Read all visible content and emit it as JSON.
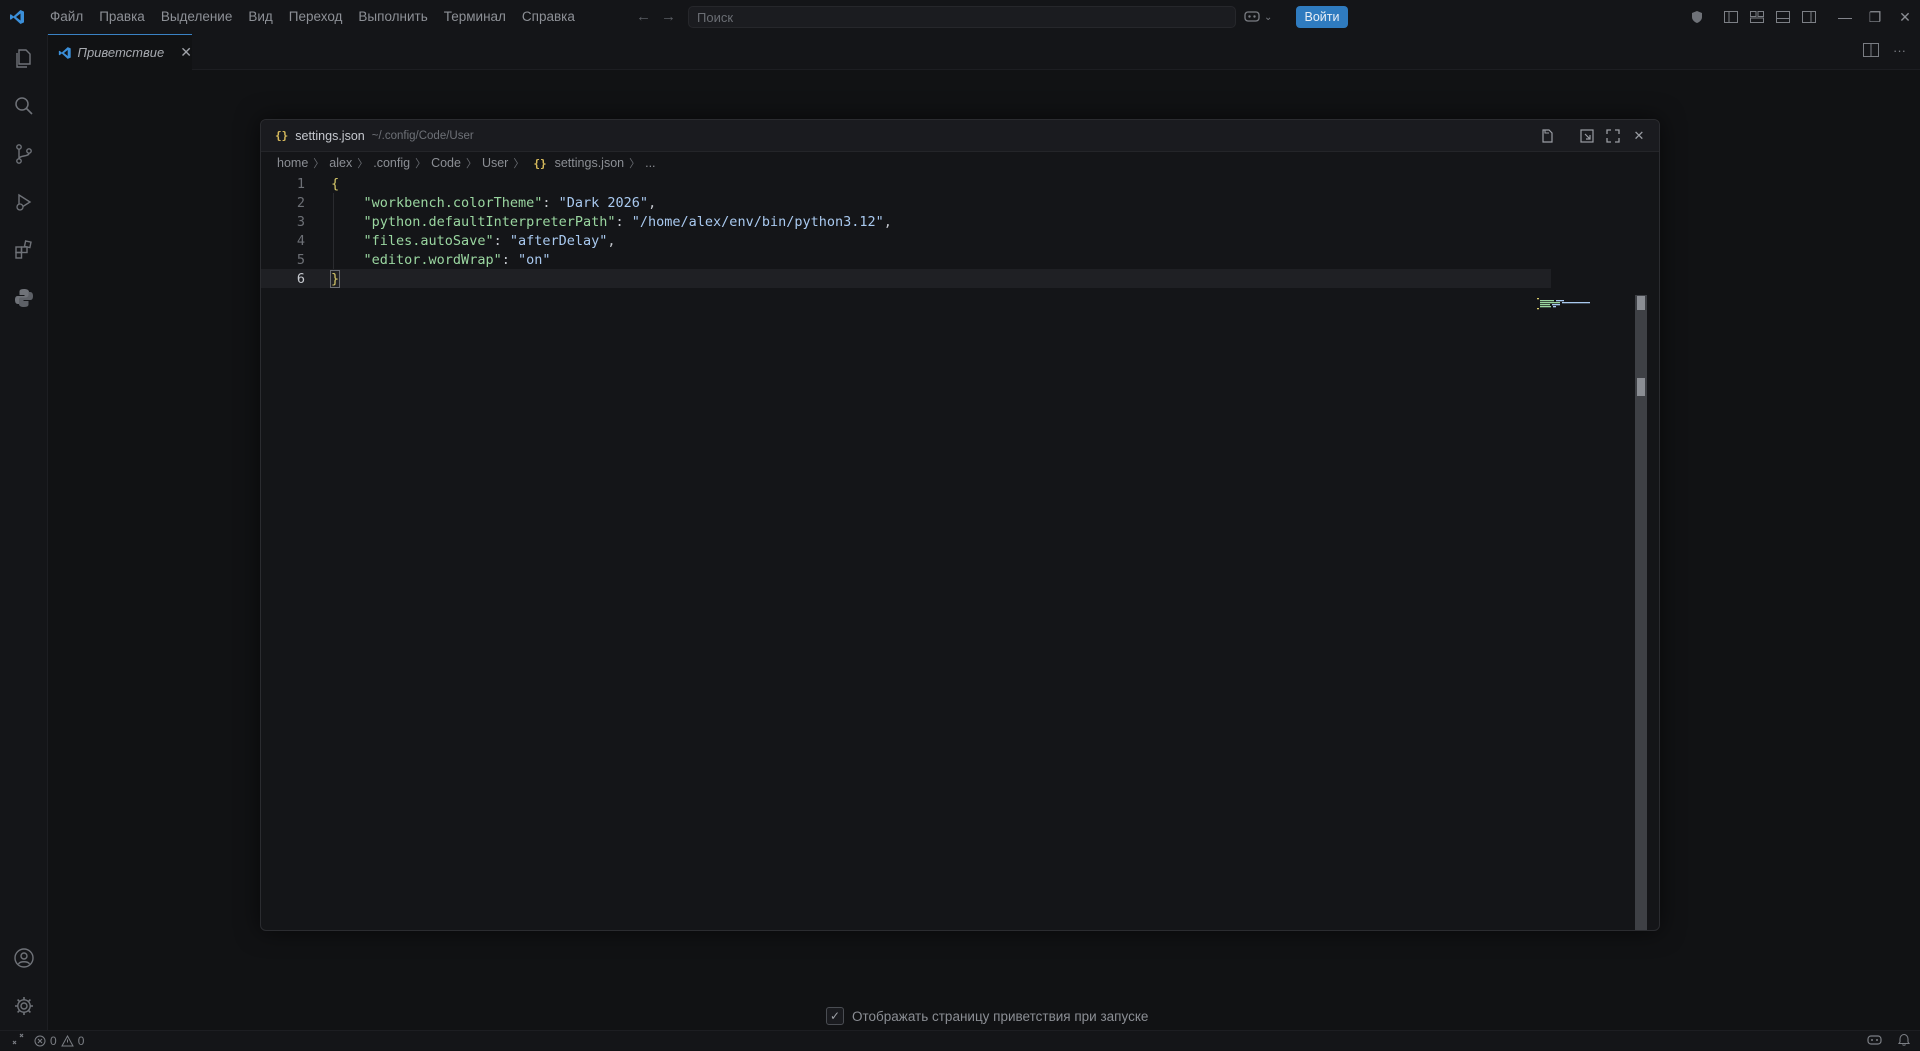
{
  "menu": [
    "Файл",
    "Правка",
    "Выделение",
    "Вид",
    "Переход",
    "Выполнить",
    "Терминал",
    "Справка"
  ],
  "search": {
    "placeholder": "Поиск"
  },
  "login_label": "Войти",
  "tab": {
    "label": "Приветствие"
  },
  "modal": {
    "title": "settings.json",
    "path": "~/.config/Code/User",
    "breadcrumb": [
      "home",
      "alex",
      ".config",
      "Code",
      "User",
      "settings.json",
      "..."
    ]
  },
  "editor": {
    "line_numbers": [
      "1",
      "2",
      "3",
      "4",
      "5",
      "6"
    ],
    "lines": [
      {
        "key": "workbench.colorTheme",
        "value": "Dark 2026",
        "comma": ","
      },
      {
        "key": "python.defaultInterpreterPath",
        "value": "/home/alex/env/bin/python3.12",
        "comma": ","
      },
      {
        "key": "files.autoSave",
        "value": "afterDelay",
        "comma": ","
      },
      {
        "key": "editor.wordWrap",
        "value": "on",
        "comma": ""
      }
    ],
    "open_brace": "{",
    "close_brace": "}"
  },
  "startup_checkbox": {
    "label": "Отображать страницу приветствия при запуске",
    "checked": true
  },
  "status": {
    "errors": "0",
    "warnings": "0"
  },
  "colors": {
    "accent": "#2f7bbf",
    "json_glyph": "#d7ba5c",
    "key": "#9ad6a0",
    "string": "#a9c9ef"
  }
}
